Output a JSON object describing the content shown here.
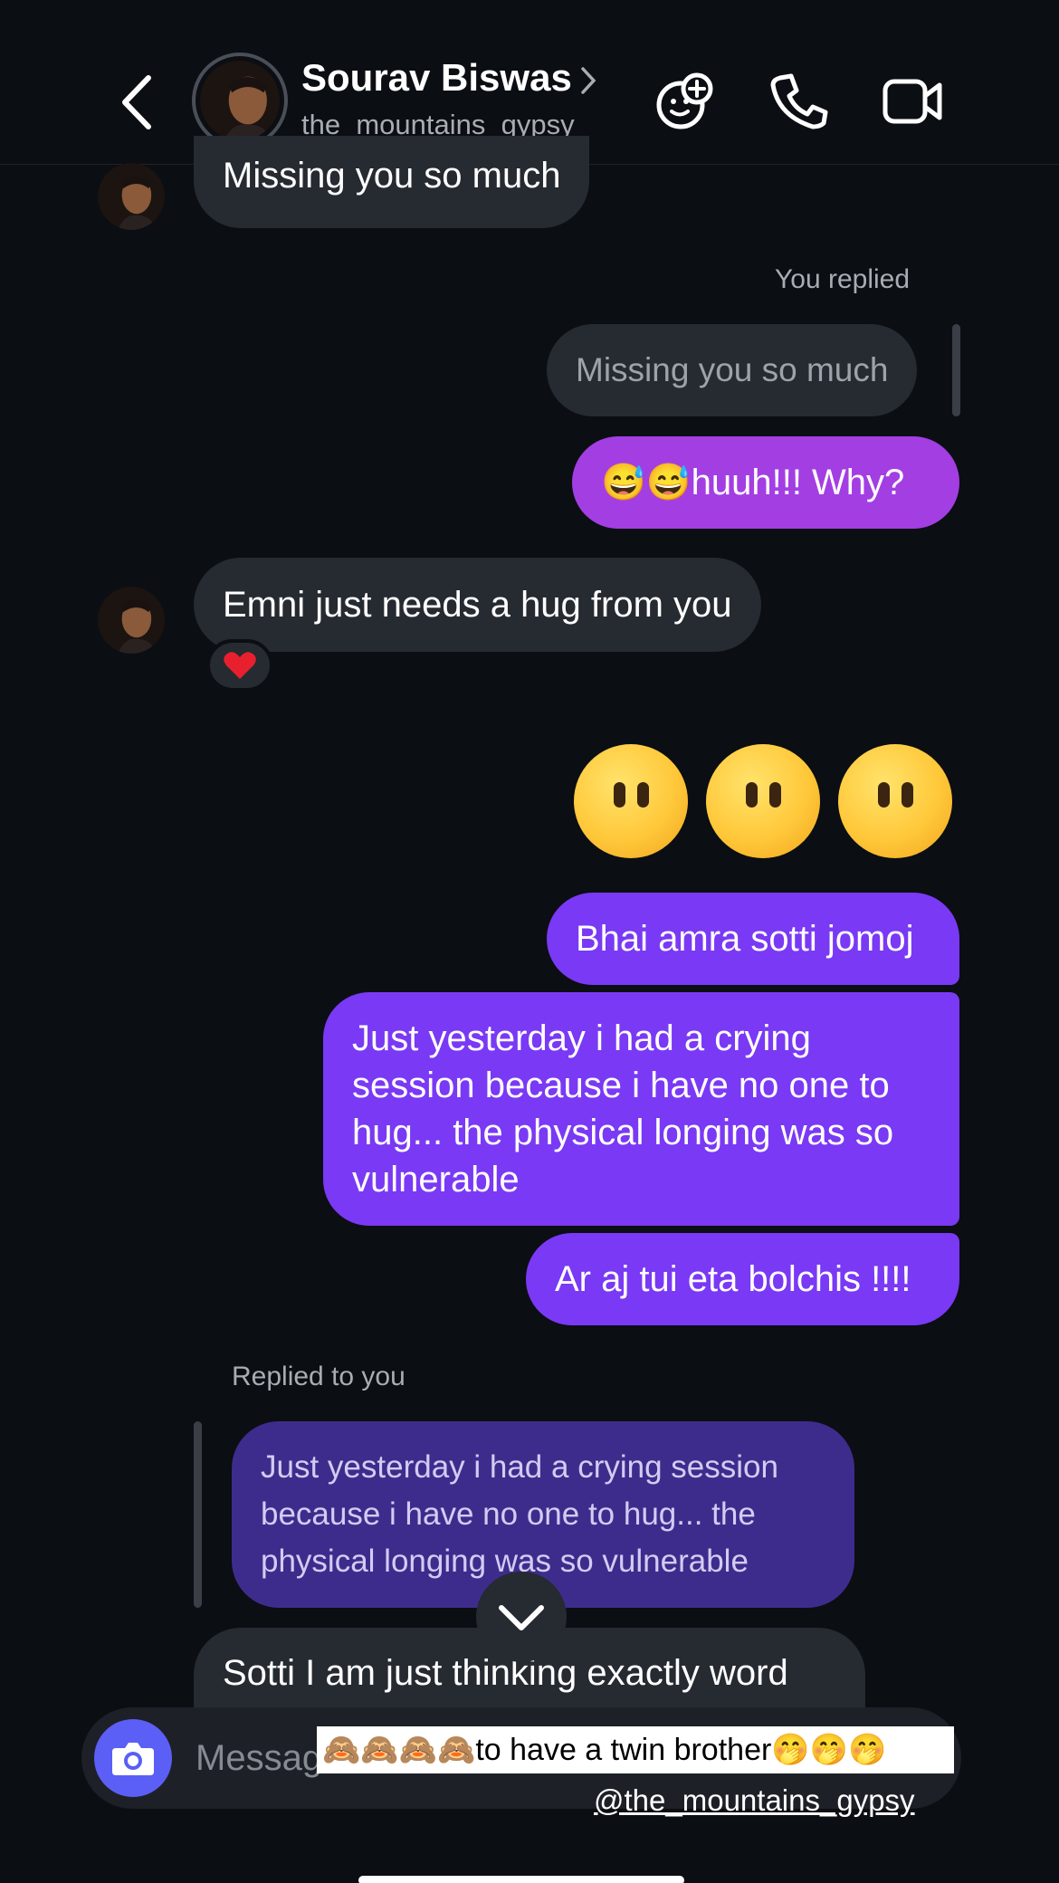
{
  "header": {
    "contact_name": "Sourav Biswas",
    "username": "the_mountains_gypsy"
  },
  "messages": {
    "m1": "Missing you so much",
    "you_replied_label": "You replied",
    "quoted_reply": "Missing you so much",
    "m2": "😅😅huuh!!! Why?",
    "m3": "Emni just needs a hug from you",
    "m3_reaction": "❤️",
    "m5": "Bhai amra sotti jomoj",
    "m6": "Just yesterday i had a crying session because i have no one to hug... the physical longing was so vulnerable",
    "m7": "Ar aj tui eta bolchis !!!!",
    "replied_to_you_label": "Replied to you",
    "quoted_reply_2": "Just yesterday i had a crying session because i have no one to hug... the physical longing was so vulnerable",
    "m8": "Sotti I am just thinking exactly word"
  },
  "compose": {
    "placeholder": "Message..."
  },
  "overlay": {
    "caption": "🙈🙈🙈🙈to have a twin brother🤭🤭🤭",
    "handle": "@the_mountains_gypsy"
  },
  "colors": {
    "background": "#0b0e13",
    "incoming_bubble": "#262a31",
    "outgoing_pink_purple": "#a33ee3",
    "outgoing_violet": "#7a39f4",
    "quoted_violet": "#3e2c8c",
    "camera_button": "#5b5ff5"
  },
  "icons": [
    "back-icon",
    "chevron-right-icon",
    "sticker-icon",
    "phone-icon",
    "video-icon",
    "camera-icon",
    "chevron-down-icon"
  ]
}
